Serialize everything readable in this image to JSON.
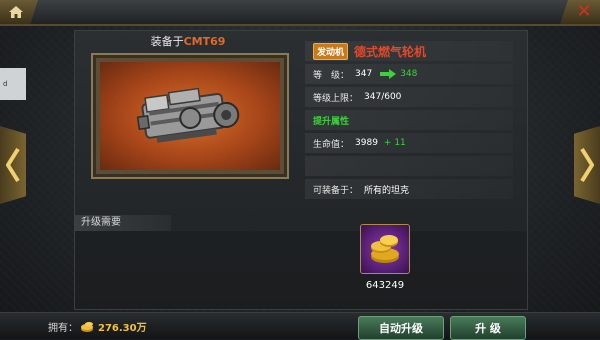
{
  "header": {
    "home_icon": "home-icon",
    "close_icon": "close-icon"
  },
  "side_tab": {
    "text": "d"
  },
  "item": {
    "equipped_prefix": "装备于",
    "equipped_model": "CMT69",
    "type_badge": "发动机",
    "name": "德式燃气轮机"
  },
  "stats": {
    "level_label": "等　级：",
    "level_current": "347",
    "level_next": "348",
    "level_cap_label": "等级上限：",
    "level_cap_value": "347/600",
    "improve_label": "提升属性",
    "hp_label": "生命值：",
    "hp_value": "3989",
    "hp_bonus": "+ 11",
    "equip_label": "可装备于：",
    "equip_value": "所有的坦克"
  },
  "upgrade": {
    "title": "升级需要",
    "cost_icon": "gold-coin-icon",
    "cost_amount": "643249"
  },
  "footer": {
    "owned_label": "拥有：",
    "owned_amount": "276.30万",
    "auto_upgrade_label": "自动升级",
    "upgrade_label": "升 级"
  },
  "colors": {
    "accent_green": "#3cd23c",
    "item_name_red": "#e04a2a",
    "badge_orange": "#c87a1a",
    "gold": "#f0c040"
  }
}
